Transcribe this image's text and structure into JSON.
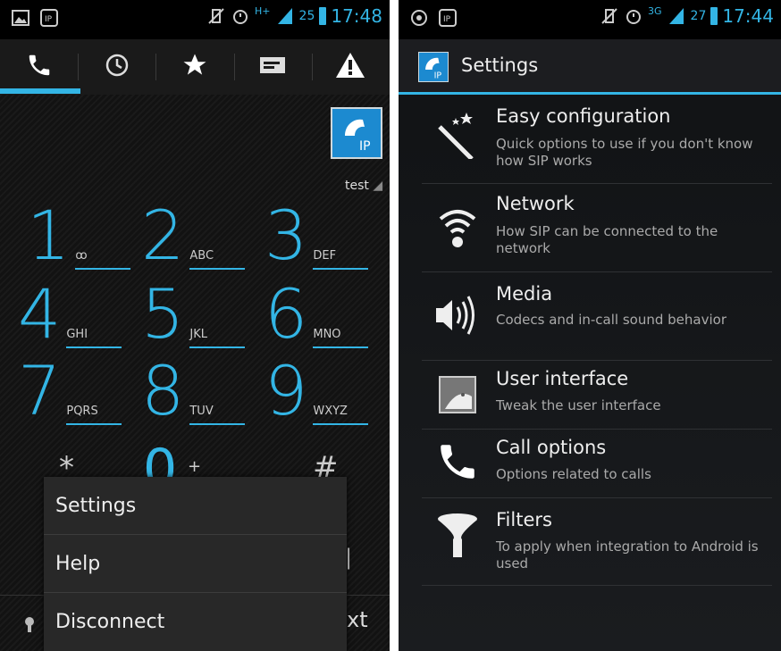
{
  "left": {
    "status": {
      "net": "H+",
      "battery": "25",
      "time": "17:48"
    },
    "tabs": [
      "phone-icon",
      "clock-icon",
      "star-icon",
      "message-icon",
      "warning-icon"
    ],
    "account": "test",
    "keys": [
      {
        "digit": "1",
        "letters": "ꝏ"
      },
      {
        "digit": "2",
        "letters": "ABC"
      },
      {
        "digit": "3",
        "letters": "DEF"
      },
      {
        "digit": "4",
        "letters": "GHI"
      },
      {
        "digit": "5",
        "letters": "JKL"
      },
      {
        "digit": "6",
        "letters": "MNO"
      },
      {
        "digit": "7",
        "letters": "PQRS"
      },
      {
        "digit": "8",
        "letters": "TUV"
      },
      {
        "digit": "9",
        "letters": "WXYZ"
      }
    ],
    "bottom_row": {
      "star": "*",
      "zero": "0",
      "plus": "+",
      "hash": "#"
    },
    "menu": [
      "Settings",
      "Help",
      "Disconnect"
    ],
    "bottom_right_text": "xt"
  },
  "right": {
    "status": {
      "net": "3G",
      "battery": "27",
      "time": "17:44"
    },
    "title": "Settings",
    "items": [
      {
        "title": "Easy configuration",
        "subtitle": "Quick options to use if you don't know how SIP works",
        "icon": "magic-wand-icon"
      },
      {
        "title": "Network",
        "subtitle": "How SIP can be connected to the network",
        "icon": "wifi-icon"
      },
      {
        "title": "Media",
        "subtitle": "Codecs and in-call sound behavior",
        "icon": "speaker-icon"
      },
      {
        "title": "User interface",
        "subtitle": "Tweak the user interface",
        "icon": "android-icon"
      },
      {
        "title": "Call options",
        "subtitle": "Options related to calls",
        "icon": "phone-icon"
      },
      {
        "title": "Filters",
        "subtitle": "To apply when integration to Android is used",
        "icon": "funnel-icon"
      }
    ]
  },
  "colors": {
    "accent": "#33b5e5",
    "status_bg": "#000000",
    "menu_bg": "#282828"
  }
}
